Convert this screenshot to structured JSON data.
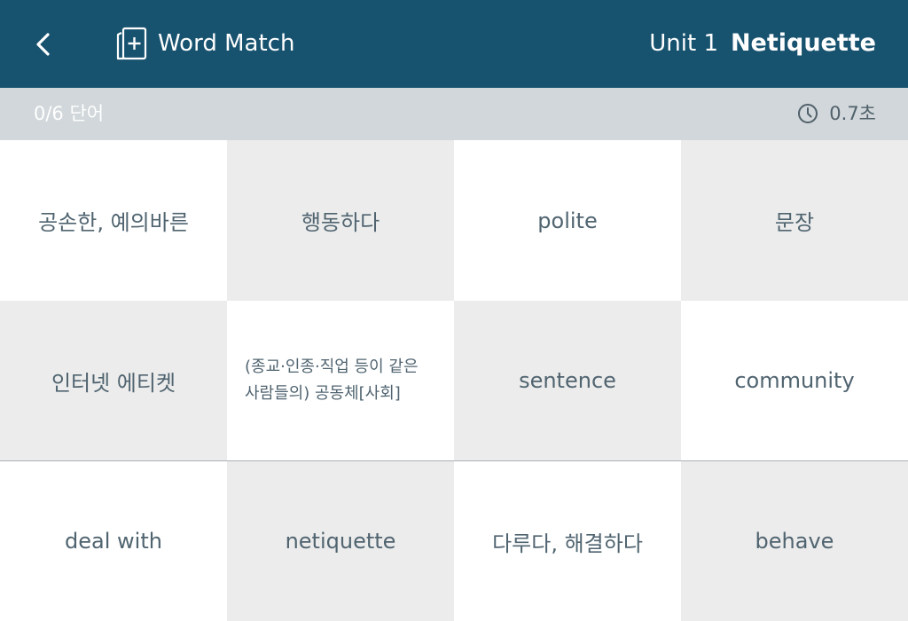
{
  "header": {
    "back_icon": "chevron-left-icon",
    "app_icon": "add-card-icon",
    "app_title": "Word Match",
    "unit_label": "Unit 1",
    "topic_title": "Netiquette"
  },
  "status": {
    "progress": "0/6 단어",
    "timer_icon": "clock-icon",
    "timer": "0.7초"
  },
  "colors": {
    "header_bg": "#17526f",
    "status_bg": "#d1d7da",
    "card_white": "#ffffff",
    "card_gray": "#ececec",
    "card_text": "#506470"
  },
  "cards": [
    {
      "text": "공손한, 예의바른"
    },
    {
      "text": "행동하다"
    },
    {
      "text": "polite"
    },
    {
      "text": "문장"
    },
    {
      "text": "인터넷 에티켓"
    },
    {
      "text": "(종교·인종·직업 등이 같은 사람들의) 공동체[사회]"
    },
    {
      "text": "sentence"
    },
    {
      "text": "community"
    },
    {
      "text": "deal with"
    },
    {
      "text": "netiquette"
    },
    {
      "text": "다루다, 해결하다"
    },
    {
      "text": "behave"
    }
  ]
}
